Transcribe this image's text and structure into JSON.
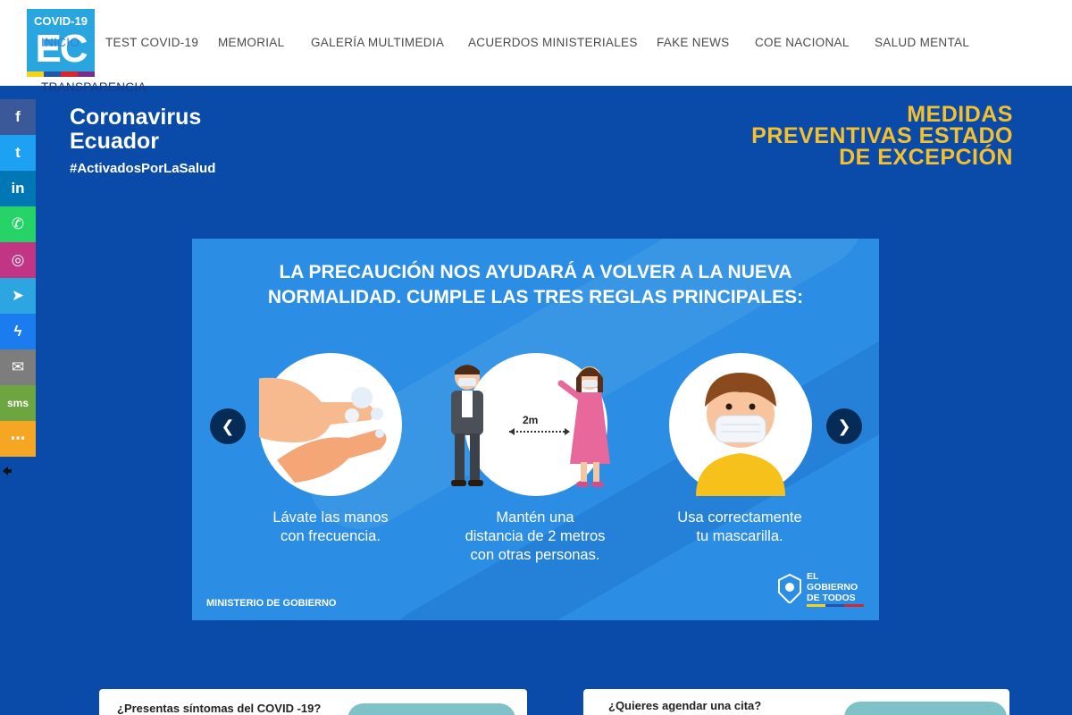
{
  "logo": {
    "top_text": "COVID-19",
    "main_text": "EC"
  },
  "nav": [
    {
      "id": "inicio",
      "label": "INICIO"
    },
    {
      "id": "test",
      "label": "TEST COVID-19"
    },
    {
      "id": "memorial",
      "label": "MEMORIAL"
    },
    {
      "id": "galeria",
      "label": "GALERÍA MULTIMEDIA"
    },
    {
      "id": "acuerdos",
      "label": "ACUERDOS MINISTERIALES"
    },
    {
      "id": "fake",
      "label": "FAKE NEWS"
    },
    {
      "id": "coe",
      "label": "COE NACIONAL"
    },
    {
      "id": "salud",
      "label": "SALUD MENTAL"
    },
    {
      "id": "transparencia",
      "label": "TRANSPARENCIA"
    }
  ],
  "hero": {
    "brand_line1": "Coronavirus",
    "brand_line2": "Ecuador",
    "hashtag": "#ActivadosPorLaSalud",
    "measures_line1": "MEDIDAS",
    "measures_line2": "PREVENTIVAS ESTADO",
    "measures_line3": "DE EXCEPCIÓN"
  },
  "social": [
    {
      "name": "facebook",
      "glyph": "f",
      "color": "#3b5998"
    },
    {
      "name": "twitter",
      "glyph": "t",
      "color": "#1da1f2"
    },
    {
      "name": "linkedin",
      "glyph": "in",
      "color": "#0077b5"
    },
    {
      "name": "whatsapp",
      "glyph": "✆",
      "color": "#25d366"
    },
    {
      "name": "instagram",
      "glyph": "◎",
      "color": "#c13584"
    },
    {
      "name": "telegram",
      "glyph": "➤",
      "color": "#2ca5e0"
    },
    {
      "name": "messenger",
      "glyph": "ϟ",
      "color": "#1b7cf0"
    },
    {
      "name": "email",
      "glyph": "✉",
      "color": "#7d7d7d"
    },
    {
      "name": "sms",
      "glyph": "sms",
      "color": "#6da541"
    },
    {
      "name": "share",
      "glyph": "⋯",
      "color": "#f5a623"
    }
  ],
  "slider": {
    "title_line1": "LA PRECAUCIÓN NOS AYUDARÁ A VOLVER A LA NUEVA",
    "title_line2": "NORMALIDAD. CUMPLE LAS TRES REGLAS PRINCIPALES:",
    "distance_label": "2m",
    "cap1_line1": "Lávate las manos",
    "cap1_line2": "con frecuencia.",
    "cap2_line1": "Mantén una",
    "cap2_line2": "distancia de 2 metros",
    "cap2_line3": "con otras personas.",
    "cap3_line1": "Usa correctamente",
    "cap3_line2": "tu mascarilla.",
    "ministry": "MINISTERIO DE GOBIERNO",
    "gov_line1": "EL",
    "gov_line2": "GOBIERNO",
    "gov_line3": "DE TODOS",
    "prev_glyph": "❮",
    "next_glyph": "❯"
  },
  "cards": {
    "left_question": "¿Presentas síntomas del COVID -19?",
    "right_question": "¿Quieres agendar una cita?"
  },
  "colors": {
    "header_bg": "#ffffff",
    "page_bg": "#0a4aa8",
    "accent_yellow": "#f4c02e",
    "slide_bg": "#2b8ee4"
  }
}
